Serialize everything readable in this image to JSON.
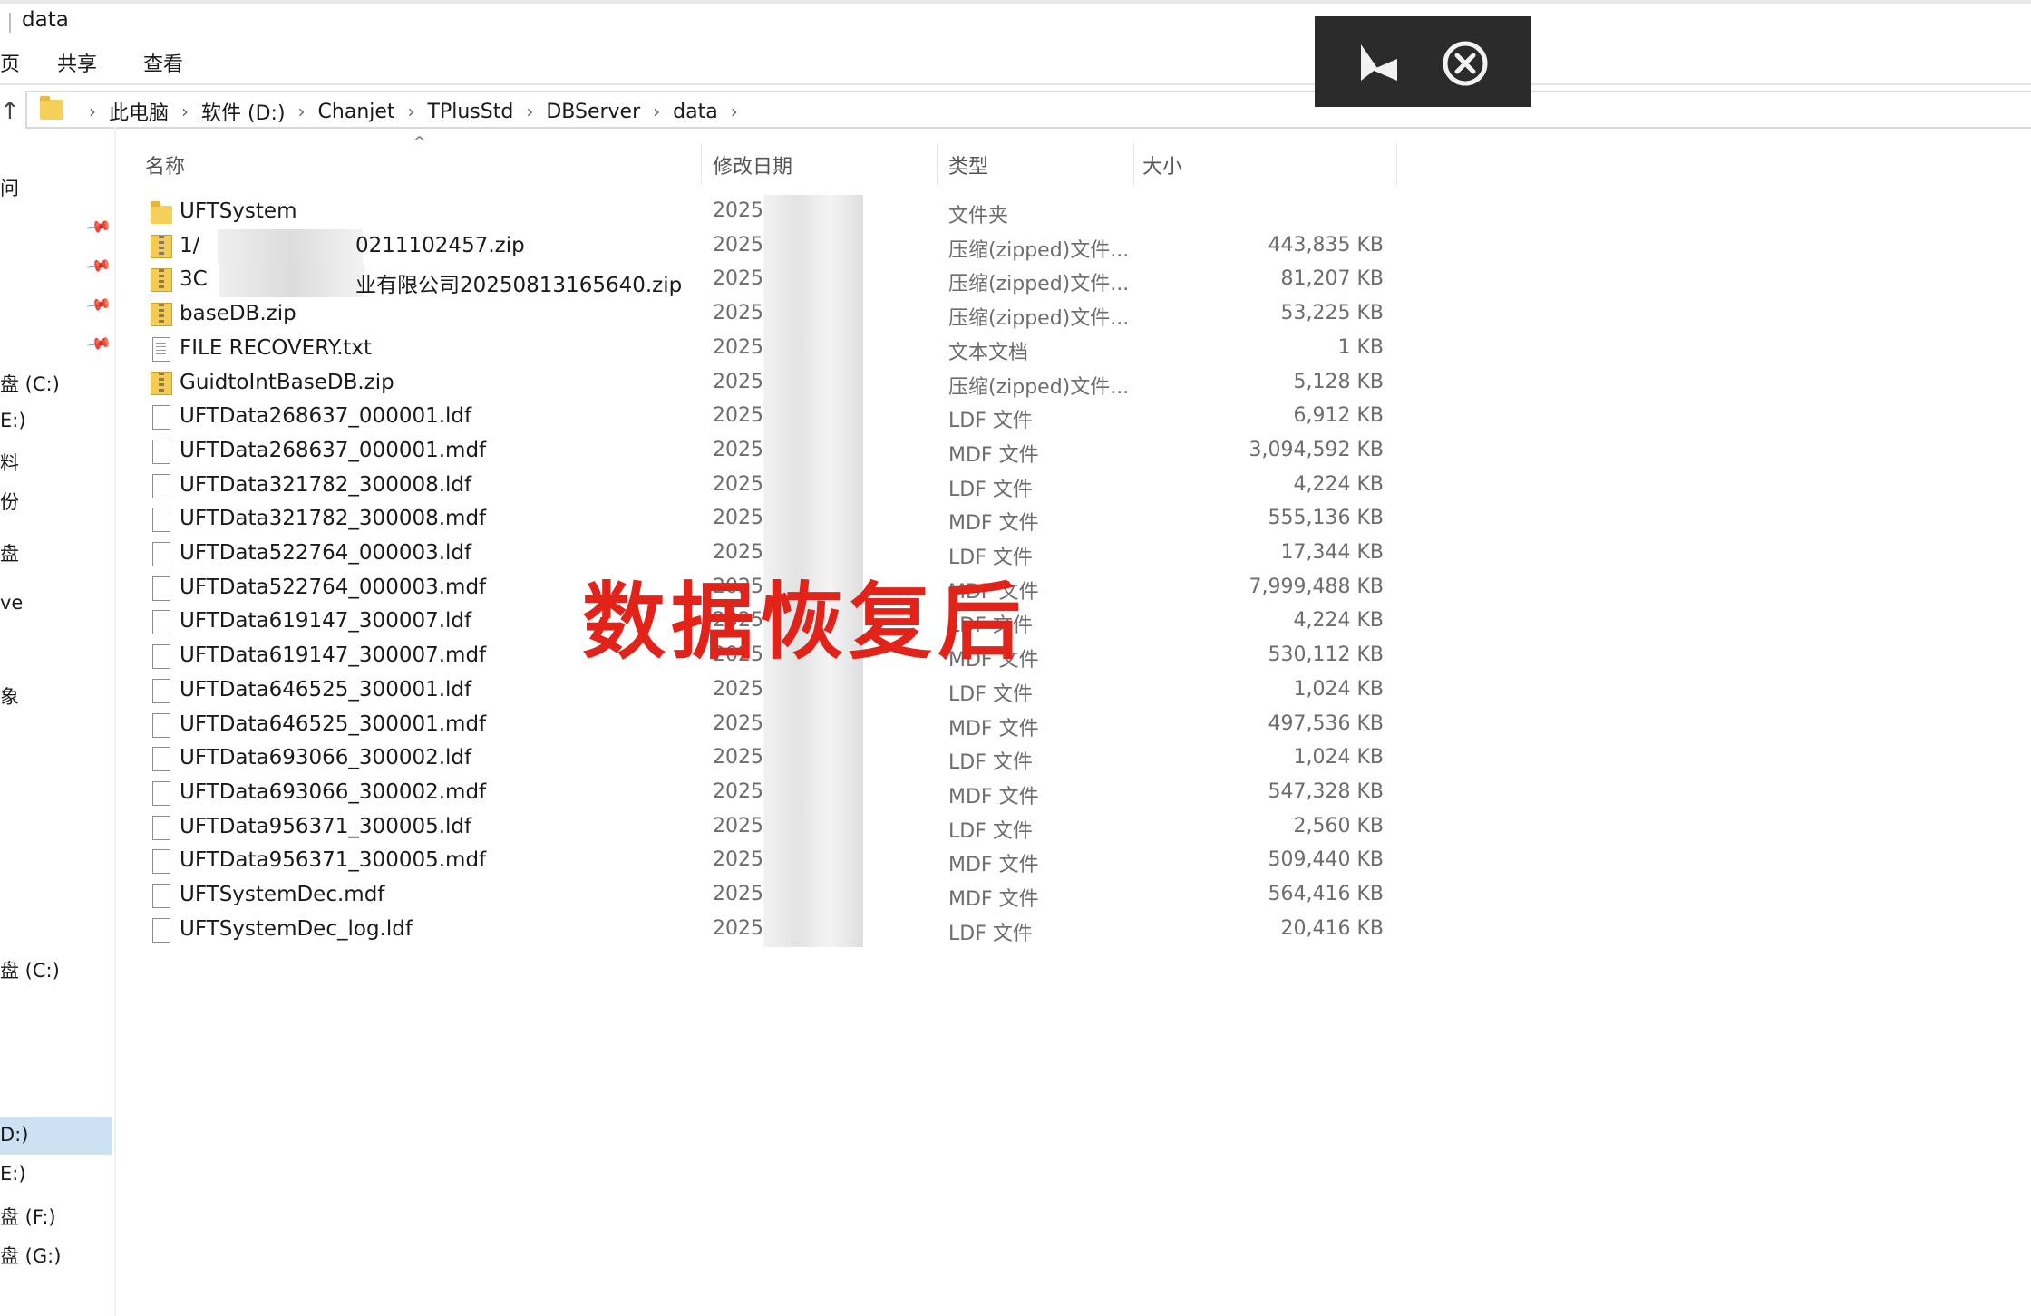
{
  "window": {
    "title": "data"
  },
  "ribbon": {
    "tabs": [
      "页",
      "共享",
      "查看"
    ]
  },
  "address": {
    "up_icon": "↑",
    "crumbs": [
      "此电脑",
      "软件 (D:)",
      "Chanjet",
      "TPlusStd",
      "DBServer",
      "data"
    ]
  },
  "columns": {
    "name": "名称",
    "date": "修改日期",
    "type": "类型",
    "size": "大小"
  },
  "nav": {
    "items": [
      "问",
      "盘 (C:)",
      "E:)",
      "料",
      "份",
      "盘",
      "ve",
      "象",
      "盘 (C:)",
      "D:)",
      "E:)",
      "盘 (F:)",
      "盘 (G:)"
    ],
    "selected": "D:)"
  },
  "files": [
    {
      "icon": "folder-icon",
      "name": "UFTSystem",
      "date": "2025/",
      "type": "文件夹",
      "size": ""
    },
    {
      "icon": "zip-icon",
      "name": "1/",
      "name_tail": "0211102457.zip",
      "date": "2025/",
      "type": "压缩(zipped)文件...",
      "size": "443,835 KB"
    },
    {
      "icon": "zip-icon",
      "name": "3C",
      "name_tail": "业有限公司20250813165640.zip",
      "date": "2025/",
      "type": "压缩(zipped)文件...",
      "size": "81,207 KB"
    },
    {
      "icon": "zip-icon",
      "name": "baseDB.zip",
      "date": "2025/",
      "type": "压缩(zipped)文件...",
      "size": "53,225 KB"
    },
    {
      "icon": "text-file-icon",
      "name": "FILE RECOVERY.txt",
      "date": "2025/",
      "type": "文本文档",
      "size": "1 KB"
    },
    {
      "icon": "zip-icon",
      "name": "GuidtoIntBaseDB.zip",
      "date": "2025/",
      "type": "压缩(zipped)文件...",
      "size": "5,128 KB"
    },
    {
      "icon": "file-icon",
      "name": "UFTData268637_000001.ldf",
      "date": "2025/",
      "type": "LDF 文件",
      "size": "6,912 KB"
    },
    {
      "icon": "file-icon",
      "name": "UFTData268637_000001.mdf",
      "date": "2025/",
      "type": "MDF 文件",
      "size": "3,094,592 KB"
    },
    {
      "icon": "file-icon",
      "name": "UFTData321782_300008.ldf",
      "date": "2025/",
      "type": "LDF 文件",
      "size": "4,224 KB"
    },
    {
      "icon": "file-icon",
      "name": "UFTData321782_300008.mdf",
      "date": "2025/",
      "type": "MDF 文件",
      "size": "555,136 KB"
    },
    {
      "icon": "file-icon",
      "name": "UFTData522764_000003.ldf",
      "date": "2025/",
      "type": "LDF 文件",
      "size": "17,344 KB"
    },
    {
      "icon": "file-icon",
      "name": "UFTData522764_000003.mdf",
      "date": "2025/",
      "type": "MDF 文件",
      "size": "7,999,488 KB"
    },
    {
      "icon": "file-icon",
      "name": "UFTData619147_300007.ldf",
      "date": "2025/",
      "type": "LDF 文件",
      "size": "4,224 KB"
    },
    {
      "icon": "file-icon",
      "name": "UFTData619147_300007.mdf",
      "date": "2025/",
      "type": "MDF 文件",
      "size": "530,112 KB"
    },
    {
      "icon": "file-icon",
      "name": "UFTData646525_300001.ldf",
      "date": "2025/",
      "type": "LDF 文件",
      "size": "1,024 KB"
    },
    {
      "icon": "file-icon",
      "name": "UFTData646525_300001.mdf",
      "date": "2025/",
      "type": "MDF 文件",
      "size": "497,536 KB"
    },
    {
      "icon": "file-icon",
      "name": "UFTData693066_300002.ldf",
      "date": "2025/",
      "type": "LDF 文件",
      "size": "1,024 KB"
    },
    {
      "icon": "file-icon",
      "name": "UFTData693066_300002.mdf",
      "date": "2025/",
      "type": "MDF 文件",
      "size": "547,328 KB"
    },
    {
      "icon": "file-icon",
      "name": "UFTData956371_300005.ldf",
      "date": "2025/",
      "type": "LDF 文件",
      "size": "2,560 KB"
    },
    {
      "icon": "file-icon",
      "name": "UFTData956371_300005.mdf",
      "date": "2025/",
      "type": "MDF 文件",
      "size": "509,440 KB"
    },
    {
      "icon": "file-icon",
      "name": "UFTSystemDec.mdf",
      "date": "2025/",
      "type": "MDF 文件",
      "size": "564,416 KB"
    },
    {
      "icon": "file-icon",
      "name": "UFTSystemDec_log.ldf",
      "date": "2025/",
      "type": "LDF 文件",
      "size": "20,416 KB"
    }
  ],
  "overlay": {
    "play_icon": "play-back-icon",
    "close_icon": "close-circle-icon"
  },
  "watermark": "数据恢复后"
}
